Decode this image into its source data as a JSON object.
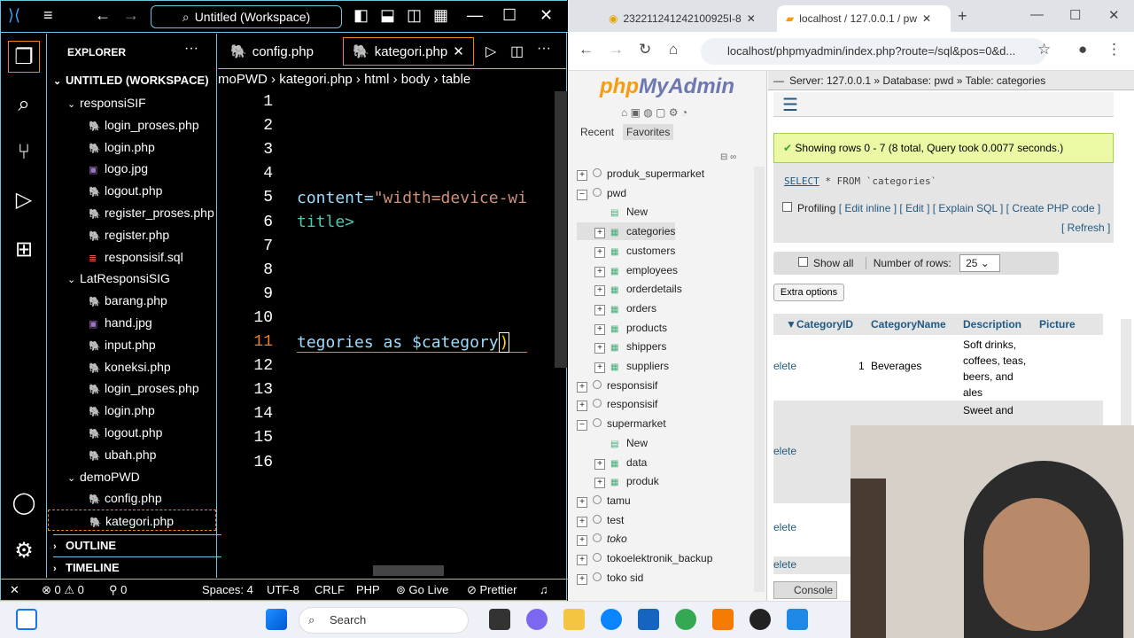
{
  "vscode": {
    "command_center": "Untitled (Workspace)",
    "explorer_label": "EXPLORER",
    "workspace_label": "UNTITLED (WORKSPACE)",
    "tree": [
      {
        "label": "responsiSIF",
        "type": "folder"
      },
      {
        "label": "login_proses.php",
        "type": "php"
      },
      {
        "label": "login.php",
        "type": "php"
      },
      {
        "label": "logo.jpg",
        "type": "img"
      },
      {
        "label": "logout.php",
        "type": "php"
      },
      {
        "label": "register_proses.php",
        "type": "php"
      },
      {
        "label": "register.php",
        "type": "php"
      },
      {
        "label": "responsisif.sql",
        "type": "sql"
      },
      {
        "label": "LatResponsiSIG",
        "type": "folder"
      },
      {
        "label": "barang.php",
        "type": "php"
      },
      {
        "label": "hand.jpg",
        "type": "img"
      },
      {
        "label": "input.php",
        "type": "php"
      },
      {
        "label": "koneksi.php",
        "type": "php"
      },
      {
        "label": "login_proses.php",
        "type": "php"
      },
      {
        "label": "login.php",
        "type": "php"
      },
      {
        "label": "logout.php",
        "type": "php"
      },
      {
        "label": "ubah.php",
        "type": "php"
      },
      {
        "label": "demoPWD",
        "type": "folder"
      },
      {
        "label": "config.php",
        "type": "php"
      },
      {
        "label": "kategori.php",
        "type": "php"
      }
    ],
    "outline_label": "OUTLINE",
    "timeline_label": "TIMELINE",
    "tab1": "config.php",
    "tab2": "kategori.php",
    "breadcrumb": [
      "moPWD",
      "kategori.php",
      "html",
      "body",
      "table"
    ],
    "line_numbers": [
      "1",
      "2",
      "3",
      "4",
      "5",
      "6",
      "7",
      "8",
      "9",
      "10",
      "11",
      "12",
      "13",
      "14",
      "15",
      "16"
    ],
    "code_line5_a": "content=",
    "code_line5_b": "\"width=device-wi",
    "code_line6": "title>",
    "code_line11_a": "tegories as ",
    "code_line11_b": "$category",
    "code_line11_c": ")",
    "status": {
      "errors": "0",
      "warnings": "0",
      "ports": "0",
      "spaces": "Spaces: 4",
      "encoding": "UTF-8",
      "eol": "CRLF",
      "lang": "PHP",
      "golive": "Go Live",
      "prettier": "Prettier"
    }
  },
  "browser": {
    "tab1": "232211241242100925I-8",
    "tab2": "localhost / 127.0.0.1 / pw",
    "url": "localhost/phpmyadmin/index.php?route=/sql&pos=0&d...",
    "logo_php": "php",
    "logo_myadmin": "MyAdmin",
    "recent": "Recent",
    "favorites": "Favorites",
    "dbs": [
      {
        "label": "produk_supermarket",
        "kind": "db",
        "sign": "+"
      },
      {
        "label": "pwd",
        "kind": "db",
        "sign": "−"
      },
      {
        "label": "New",
        "kind": "new"
      },
      {
        "label": "categories",
        "kind": "table",
        "sign": "+"
      },
      {
        "label": "customers",
        "kind": "table",
        "sign": "+"
      },
      {
        "label": "employees",
        "kind": "table",
        "sign": "+"
      },
      {
        "label": "orderdetails",
        "kind": "table",
        "sign": "+"
      },
      {
        "label": "orders",
        "kind": "table",
        "sign": "+"
      },
      {
        "label": "products",
        "kind": "table",
        "sign": "+"
      },
      {
        "label": "shippers",
        "kind": "table",
        "sign": "+"
      },
      {
        "label": "suppliers",
        "kind": "table",
        "sign": "+"
      },
      {
        "label": "responsisif",
        "kind": "db",
        "sign": "+"
      },
      {
        "label": "responsisif",
        "kind": "db",
        "sign": "+"
      },
      {
        "label": "supermarket",
        "kind": "db",
        "sign": "−"
      },
      {
        "label": "New",
        "kind": "new"
      },
      {
        "label": "data",
        "kind": "table",
        "sign": "+"
      },
      {
        "label": "produk",
        "kind": "table",
        "sign": "+"
      },
      {
        "label": "tamu",
        "kind": "db",
        "sign": "+"
      },
      {
        "label": "test",
        "kind": "db",
        "sign": "+"
      },
      {
        "label": "toko",
        "kind": "db",
        "sign": "+"
      },
      {
        "label": "tokoelektronik_backup",
        "kind": "db",
        "sign": "+"
      },
      {
        "label": "toko sid",
        "kind": "db",
        "sign": "+"
      }
    ],
    "breadcrumb": "Server: 127.0.0.1 » Database: pwd » Table: categories",
    "success": "Showing rows 0 - 7 (8 total, Query took 0.0077 seconds.)",
    "sql_kw": "SELECT",
    "sql_rest": " * FROM `categories`",
    "profiling": "Profiling",
    "links": "[ Edit inline ] [ Edit ] [ Explain SQL ] [ Create PHP code ]",
    "refresh": "[ Refresh ]",
    "show_all": "Show all",
    "num_rows_label": "Number of rows:",
    "num_rows": "25",
    "extra_options": "Extra options",
    "columns": [
      "CategoryID",
      "CategoryName",
      "Description",
      "Picture"
    ],
    "row1": {
      "action": "elete",
      "id": "1",
      "name": "Beverages",
      "desc": "Soft drinks, coffees, teas, beers, and ales"
    },
    "row2": {
      "desc": "Sweet and",
      "action": "elete"
    },
    "row3": {
      "action": "elete"
    },
    "row4": {
      "action": "elete"
    },
    "console": "Console"
  },
  "taskbar": {
    "search": "Search"
  }
}
